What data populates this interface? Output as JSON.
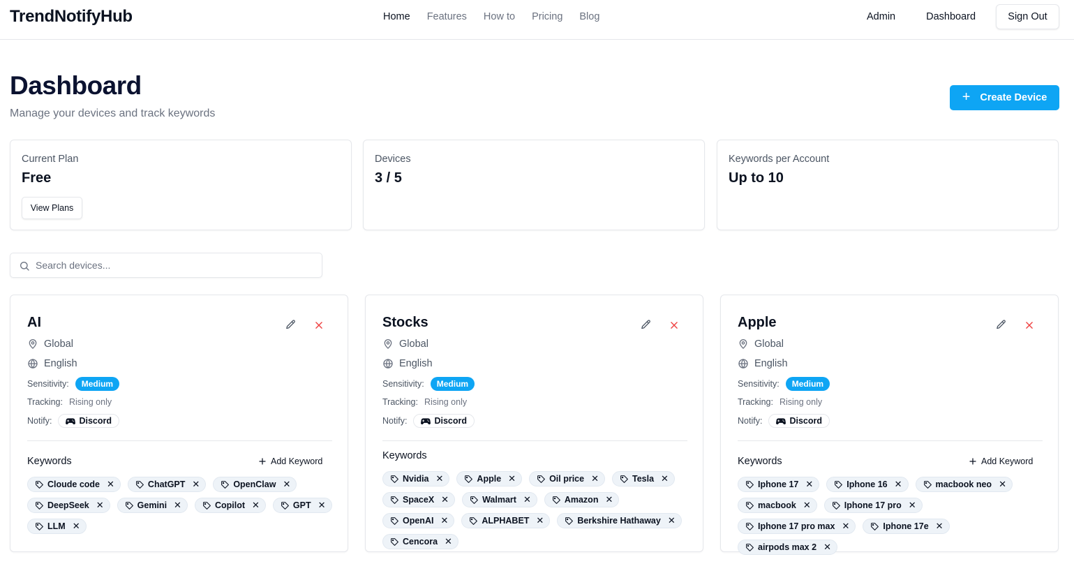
{
  "header": {
    "brand": "TrendNotifyHub",
    "nav": [
      "Home",
      "Features",
      "How to",
      "Pricing",
      "Blog"
    ],
    "admin": "Admin",
    "dashboard": "Dashboard",
    "sign_out": "Sign Out"
  },
  "page": {
    "title": "Dashboard",
    "subtitle": "Manage your devices and track keywords",
    "create_button": "Create Device"
  },
  "stats": [
    {
      "label": "Current Plan",
      "value": "Free",
      "button": "View Plans"
    },
    {
      "label": "Devices",
      "value": "3 / 5"
    },
    {
      "label": "Keywords per Account",
      "value": "Up to 10"
    }
  ],
  "search": {
    "placeholder": "Search devices..."
  },
  "devices": [
    {
      "name": "AI",
      "location": "Global",
      "language": "English",
      "sensitivity_label": "Sensitivity:",
      "sensitivity": "Medium",
      "tracking_label": "Tracking:",
      "tracking": "Rising only",
      "notify_label": "Notify:",
      "notify": "Discord",
      "keywords_title": "Keywords",
      "add_keyword": "Add Keyword",
      "keywords": [
        "Cloude code",
        "ChatGPT",
        "OpenClaw",
        "DeepSeek",
        "Gemini",
        "Copilot",
        "GPT",
        "LLM"
      ]
    },
    {
      "name": "Stocks",
      "location": "Global",
      "language": "English",
      "sensitivity_label": "Sensitivity:",
      "sensitivity": "Medium",
      "tracking_label": "Tracking:",
      "tracking": "Rising only",
      "notify_label": "Notify:",
      "notify": "Discord",
      "keywords_title": "Keywords",
      "keywords": [
        "Nvidia",
        "Apple",
        "Oil price",
        "Tesla",
        "SpaceX",
        "Walmart",
        "Amazon",
        "OpenAI",
        "ALPHABET",
        "Berkshire Hathaway",
        "Cencora"
      ]
    },
    {
      "name": "Apple",
      "location": "Global",
      "language": "English",
      "sensitivity_label": "Sensitivity:",
      "sensitivity": "Medium",
      "tracking_label": "Tracking:",
      "tracking": "Rising only",
      "notify_label": "Notify:",
      "notify": "Discord",
      "keywords_title": "Keywords",
      "add_keyword": "Add Keyword",
      "keywords": [
        "Iphone 17",
        "Iphone 16",
        "macbook neo",
        "macbook",
        "Iphone 17 pro",
        "Iphone 17 pro max",
        "Iphone 17e",
        "airpods max 2"
      ]
    }
  ],
  "colors": {
    "accent": "#0ea5f4",
    "delete": "#ef4444",
    "chip_bg": "#eef3f8"
  },
  "icons": {
    "location": "map-pin-icon",
    "language": "globe-icon",
    "edit": "pencil-icon",
    "delete": "x-icon",
    "tag": "tag-icon",
    "discord": "gamepad-icon",
    "search": "search-icon",
    "plus": "plus-icon"
  }
}
